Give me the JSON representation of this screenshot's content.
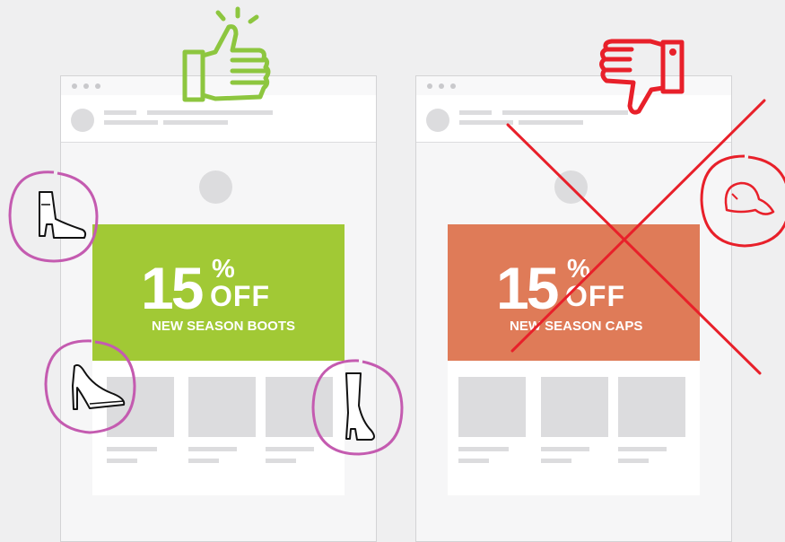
{
  "colors": {
    "good_banner": "#a1c935",
    "bad_banner": "#df7b58",
    "thumbs_up": "#8dc63f",
    "thumbs_down": "#e8202a",
    "cross": "#e8202a",
    "ring": "#c45bb0"
  },
  "good_ad": {
    "number": "15",
    "percent": "%",
    "off": "OFF",
    "headline": "NEW SEASON BOOTS"
  },
  "bad_ad": {
    "number": "15",
    "percent": "%",
    "off": "OFF",
    "headline": "NEW SEASON CAPS"
  },
  "icons": {
    "good_verdict": "thumbs-up-icon",
    "bad_verdict": "thumbs-down-icon",
    "bad_mark": "cross-out-icon",
    "good_products": [
      "ankle-boot-icon",
      "high-heel-icon",
      "tall-boot-icon"
    ],
    "bad_products": [
      "cap-icon"
    ]
  }
}
